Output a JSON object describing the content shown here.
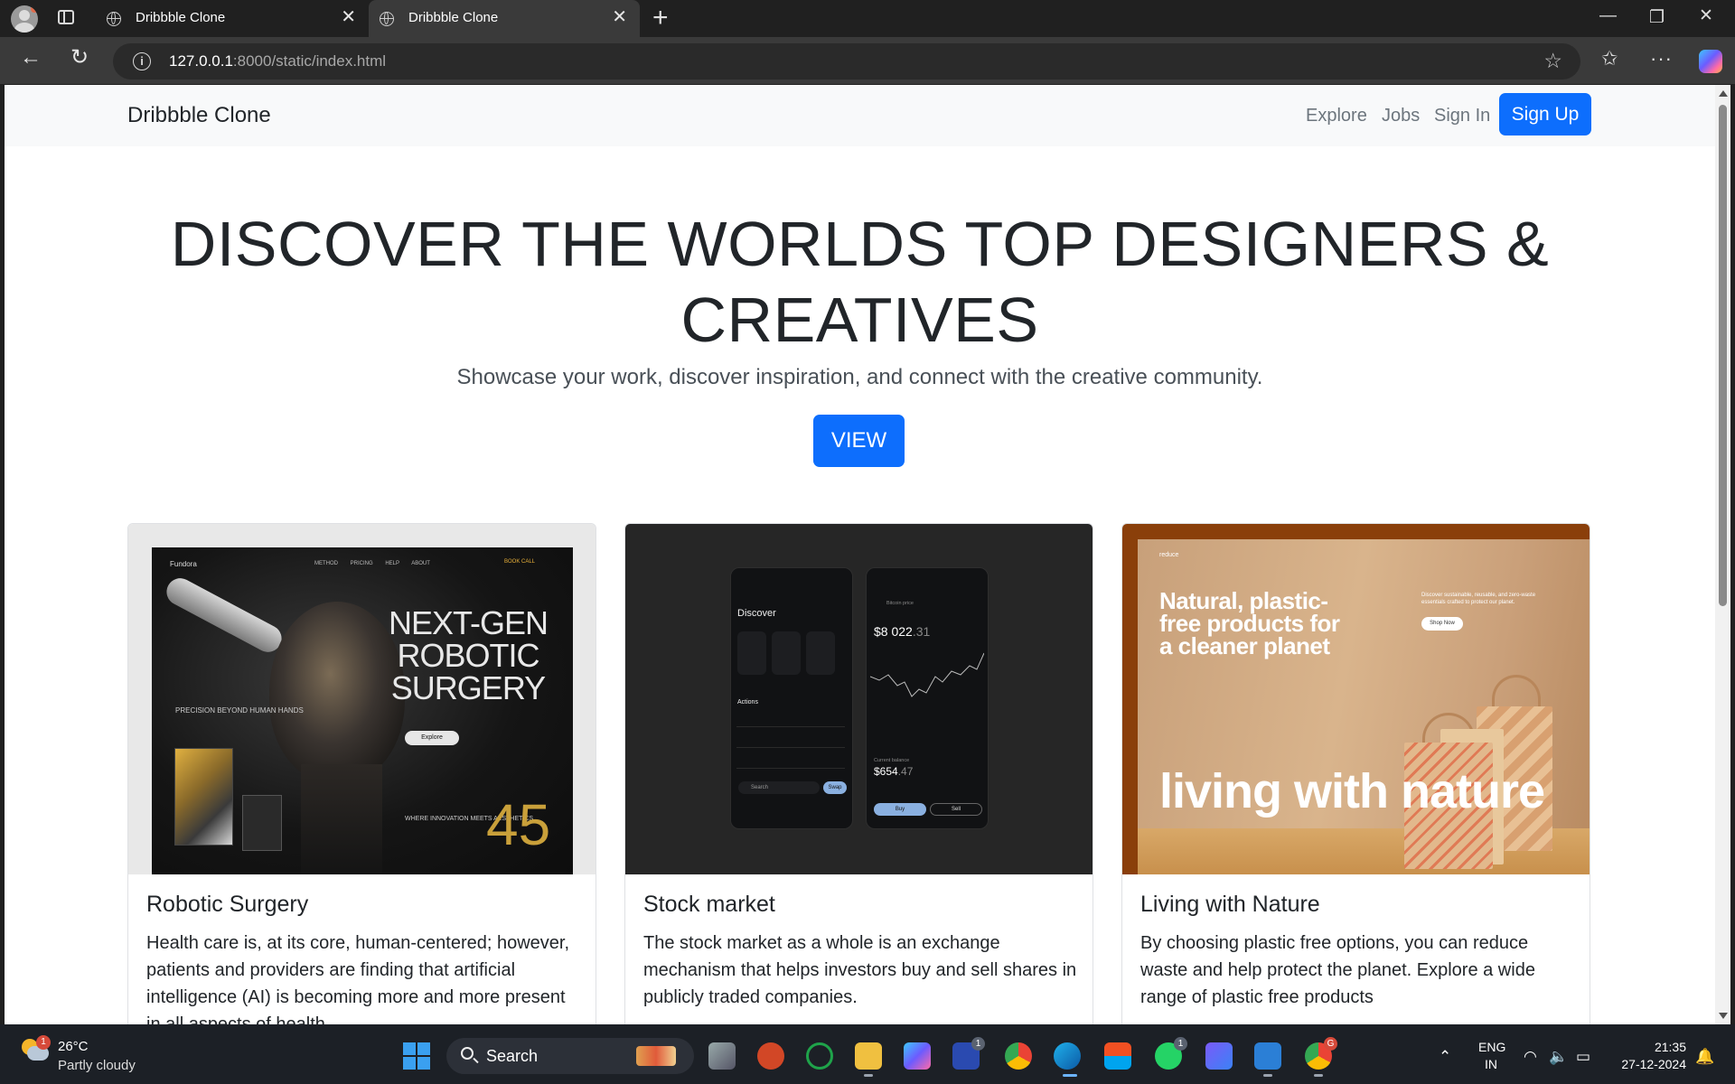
{
  "browser": {
    "tabs": [
      {
        "title": "Dribbble Clone",
        "active": false
      },
      {
        "title": "Dribbble Clone",
        "active": true
      }
    ],
    "url_host": "127.0.0.1",
    "url_rest": ":8000/static/index.html"
  },
  "page": {
    "brand": "Dribbble Clone",
    "nav": {
      "explore": "Explore",
      "jobs": "Jobs",
      "sign_in": "Sign In",
      "sign_up": "Sign Up"
    },
    "hero": {
      "title": "DISCOVER THE WORLDS TOP DESIGNERS & CREATIVES",
      "subtitle": "Showcase your work, discover inspiration, and connect with the creative community.",
      "button": "VIEW"
    },
    "cards": [
      {
        "title": "Robotic Surgery",
        "text": "Health care is, at its core, human-centered; however, patients and providers are finding that artificial intelligence (AI) is becoming more and more present in all aspects of health.",
        "image": {
          "brand": "Fundora",
          "menu": "METHOD PRICING HELP ABOUT",
          "cta": "BOOK CALL",
          "headline": "NEXT-GEN ROBOTIC SURGERY",
          "side": "PRECISION BEYOND HUMAN HANDS",
          "explore": "Explore",
          "small": "WHERE INNOVATION MEETS AESTHETICS",
          "number": "45"
        }
      },
      {
        "title": "Stock market",
        "text": "The stock market as a whole is an exchange mechanism that helps investors buy and sell shares in publicly traded companies.",
        "image": {
          "discover": "Discover",
          "actions": "Actions",
          "bitcoin_price_label": "Bitcoin price",
          "bitcoin_price": "$8 022",
          "bitcoin_price_cents": ".31",
          "balance_label": "Current balance",
          "balance": "$654",
          "balance_cents": ".47",
          "search": "Search",
          "swap": "Swap",
          "buy": "Buy",
          "sell": "Sell"
        }
      },
      {
        "title": "Living with Nature",
        "text": "By choosing plastic free options, you can reduce waste and help protect the planet. Explore a wide range of plastic free products",
        "image": {
          "logo": "reduce",
          "headline": "Natural, plastic-free products for a cleaner planet",
          "tagline": "living with nature",
          "blurb": "Discover sustainable, reusable, and zero-waste essentials crafted to protect our planet.",
          "shop": "Shop Now"
        }
      }
    ]
  },
  "taskbar": {
    "temperature": "26°C",
    "condition": "Partly cloudy",
    "weather_badge": "1",
    "search": "Search",
    "lang1": "ENG",
    "lang2": "IN",
    "time": "21:35",
    "date": "27-12-2024",
    "badges": {
      "teams": "1",
      "whatsapp": "1",
      "chrome_profile": "G"
    }
  }
}
